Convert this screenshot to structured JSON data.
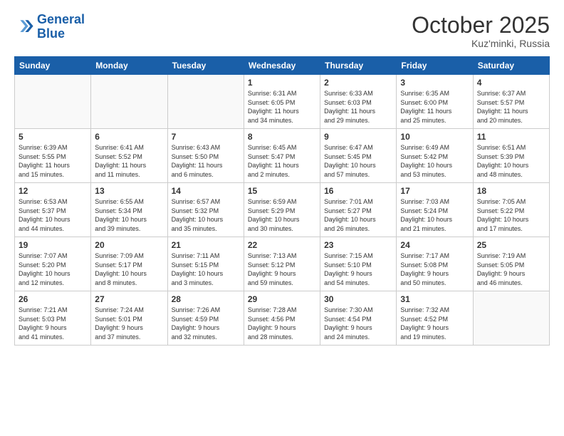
{
  "header": {
    "logo_line1": "General",
    "logo_line2": "Blue",
    "month": "October 2025",
    "location": "Kuz'minki, Russia"
  },
  "weekdays": [
    "Sunday",
    "Monday",
    "Tuesday",
    "Wednesday",
    "Thursday",
    "Friday",
    "Saturday"
  ],
  "weeks": [
    [
      {
        "num": "",
        "info": ""
      },
      {
        "num": "",
        "info": ""
      },
      {
        "num": "",
        "info": ""
      },
      {
        "num": "1",
        "info": "Sunrise: 6:31 AM\nSunset: 6:05 PM\nDaylight: 11 hours\nand 34 minutes."
      },
      {
        "num": "2",
        "info": "Sunrise: 6:33 AM\nSunset: 6:03 PM\nDaylight: 11 hours\nand 29 minutes."
      },
      {
        "num": "3",
        "info": "Sunrise: 6:35 AM\nSunset: 6:00 PM\nDaylight: 11 hours\nand 25 minutes."
      },
      {
        "num": "4",
        "info": "Sunrise: 6:37 AM\nSunset: 5:57 PM\nDaylight: 11 hours\nand 20 minutes."
      }
    ],
    [
      {
        "num": "5",
        "info": "Sunrise: 6:39 AM\nSunset: 5:55 PM\nDaylight: 11 hours\nand 15 minutes."
      },
      {
        "num": "6",
        "info": "Sunrise: 6:41 AM\nSunset: 5:52 PM\nDaylight: 11 hours\nand 11 minutes."
      },
      {
        "num": "7",
        "info": "Sunrise: 6:43 AM\nSunset: 5:50 PM\nDaylight: 11 hours\nand 6 minutes."
      },
      {
        "num": "8",
        "info": "Sunrise: 6:45 AM\nSunset: 5:47 PM\nDaylight: 11 hours\nand 2 minutes."
      },
      {
        "num": "9",
        "info": "Sunrise: 6:47 AM\nSunset: 5:45 PM\nDaylight: 10 hours\nand 57 minutes."
      },
      {
        "num": "10",
        "info": "Sunrise: 6:49 AM\nSunset: 5:42 PM\nDaylight: 10 hours\nand 53 minutes."
      },
      {
        "num": "11",
        "info": "Sunrise: 6:51 AM\nSunset: 5:39 PM\nDaylight: 10 hours\nand 48 minutes."
      }
    ],
    [
      {
        "num": "12",
        "info": "Sunrise: 6:53 AM\nSunset: 5:37 PM\nDaylight: 10 hours\nand 44 minutes."
      },
      {
        "num": "13",
        "info": "Sunrise: 6:55 AM\nSunset: 5:34 PM\nDaylight: 10 hours\nand 39 minutes."
      },
      {
        "num": "14",
        "info": "Sunrise: 6:57 AM\nSunset: 5:32 PM\nDaylight: 10 hours\nand 35 minutes."
      },
      {
        "num": "15",
        "info": "Sunrise: 6:59 AM\nSunset: 5:29 PM\nDaylight: 10 hours\nand 30 minutes."
      },
      {
        "num": "16",
        "info": "Sunrise: 7:01 AM\nSunset: 5:27 PM\nDaylight: 10 hours\nand 26 minutes."
      },
      {
        "num": "17",
        "info": "Sunrise: 7:03 AM\nSunset: 5:24 PM\nDaylight: 10 hours\nand 21 minutes."
      },
      {
        "num": "18",
        "info": "Sunrise: 7:05 AM\nSunset: 5:22 PM\nDaylight: 10 hours\nand 17 minutes."
      }
    ],
    [
      {
        "num": "19",
        "info": "Sunrise: 7:07 AM\nSunset: 5:20 PM\nDaylight: 10 hours\nand 12 minutes."
      },
      {
        "num": "20",
        "info": "Sunrise: 7:09 AM\nSunset: 5:17 PM\nDaylight: 10 hours\nand 8 minutes."
      },
      {
        "num": "21",
        "info": "Sunrise: 7:11 AM\nSunset: 5:15 PM\nDaylight: 10 hours\nand 3 minutes."
      },
      {
        "num": "22",
        "info": "Sunrise: 7:13 AM\nSunset: 5:12 PM\nDaylight: 9 hours\nand 59 minutes."
      },
      {
        "num": "23",
        "info": "Sunrise: 7:15 AM\nSunset: 5:10 PM\nDaylight: 9 hours\nand 54 minutes."
      },
      {
        "num": "24",
        "info": "Sunrise: 7:17 AM\nSunset: 5:08 PM\nDaylight: 9 hours\nand 50 minutes."
      },
      {
        "num": "25",
        "info": "Sunrise: 7:19 AM\nSunset: 5:05 PM\nDaylight: 9 hours\nand 46 minutes."
      }
    ],
    [
      {
        "num": "26",
        "info": "Sunrise: 7:21 AM\nSunset: 5:03 PM\nDaylight: 9 hours\nand 41 minutes."
      },
      {
        "num": "27",
        "info": "Sunrise: 7:24 AM\nSunset: 5:01 PM\nDaylight: 9 hours\nand 37 minutes."
      },
      {
        "num": "28",
        "info": "Sunrise: 7:26 AM\nSunset: 4:59 PM\nDaylight: 9 hours\nand 32 minutes."
      },
      {
        "num": "29",
        "info": "Sunrise: 7:28 AM\nSunset: 4:56 PM\nDaylight: 9 hours\nand 28 minutes."
      },
      {
        "num": "30",
        "info": "Sunrise: 7:30 AM\nSunset: 4:54 PM\nDaylight: 9 hours\nand 24 minutes."
      },
      {
        "num": "31",
        "info": "Sunrise: 7:32 AM\nSunset: 4:52 PM\nDaylight: 9 hours\nand 19 minutes."
      },
      {
        "num": "",
        "info": ""
      }
    ]
  ]
}
